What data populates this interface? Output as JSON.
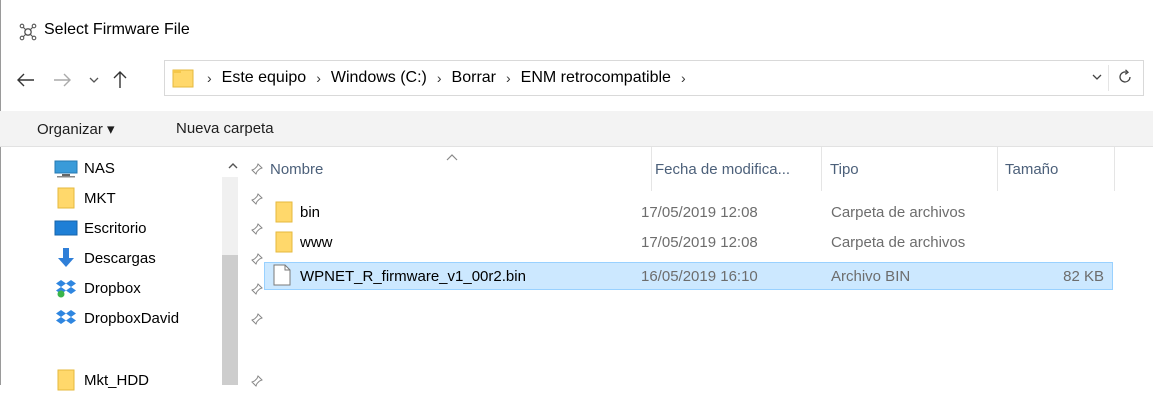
{
  "window": {
    "title": "Select Firmware File"
  },
  "address": {
    "crumbs": [
      "Este equipo",
      "Windows (C:)",
      "Borrar",
      "ENM retrocompatible"
    ]
  },
  "toolbar": {
    "organize_label": "Organizar ▾",
    "new_folder_label": "Nueva carpeta"
  },
  "nav_pane": {
    "items": [
      {
        "label": "NAS",
        "icon": "network-drive-icon"
      },
      {
        "label": "MKT",
        "icon": "folder-icon"
      },
      {
        "label": "Escritorio",
        "icon": "desktop-icon"
      },
      {
        "label": "Descargas",
        "icon": "download-icon"
      },
      {
        "label": "Dropbox",
        "icon": "dropbox-icon"
      },
      {
        "label": "DropboxDavid",
        "icon": "dropbox-icon"
      },
      {
        "label": "Mkt_HDD",
        "icon": "folder-icon"
      }
    ]
  },
  "columns": {
    "name": "Nombre",
    "date": "Fecha de modifica...",
    "type": "Tipo",
    "size": "Tamaño"
  },
  "files": [
    {
      "name": "bin",
      "date": "17/05/2019 12:08",
      "type": "Carpeta de archivos",
      "size": "",
      "kind": "folder",
      "selected": false
    },
    {
      "name": "www",
      "date": "17/05/2019 12:08",
      "type": "Carpeta de archivos",
      "size": "",
      "kind": "folder",
      "selected": false
    },
    {
      "name": "WPNET_R_firmware_v1_00r2.bin",
      "date": "16/05/2019 16:10",
      "type": "Archivo BIN",
      "size": "82 KB",
      "kind": "file",
      "selected": true
    }
  ],
  "colors": {
    "selection_bg": "#cce8ff",
    "selection_border": "#99d1ff",
    "folder": "#ffd86b",
    "header_text": "#4c607a"
  }
}
